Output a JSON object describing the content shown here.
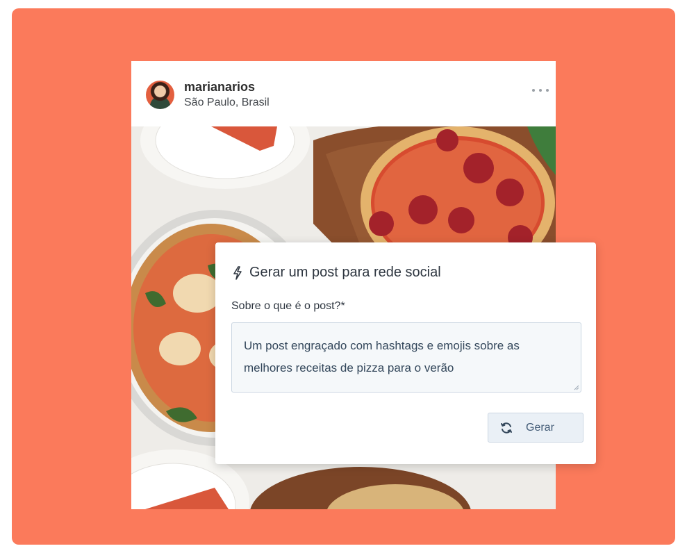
{
  "post": {
    "username": "marianarios",
    "location": "São Paulo, Brasil",
    "avatar_icon": "user-avatar-icon",
    "more_icon": "more-horizontal-icon"
  },
  "generator": {
    "title": "Gerar um post para rede social",
    "title_icon": "lightning-bolt-icon",
    "prompt_label": "Sobre o que é o post?*",
    "prompt_value": "Um post engraçado com hashtags e emojis sobre as melhores receitas de pizza para o verão",
    "generate_label": "Gerar",
    "generate_icon": "refresh-icon"
  },
  "colors": {
    "background": "#fb7a5b",
    "panel_text": "#2e3640",
    "button_bg": "#eaf0f6",
    "field_border": "#cbd6e2"
  }
}
